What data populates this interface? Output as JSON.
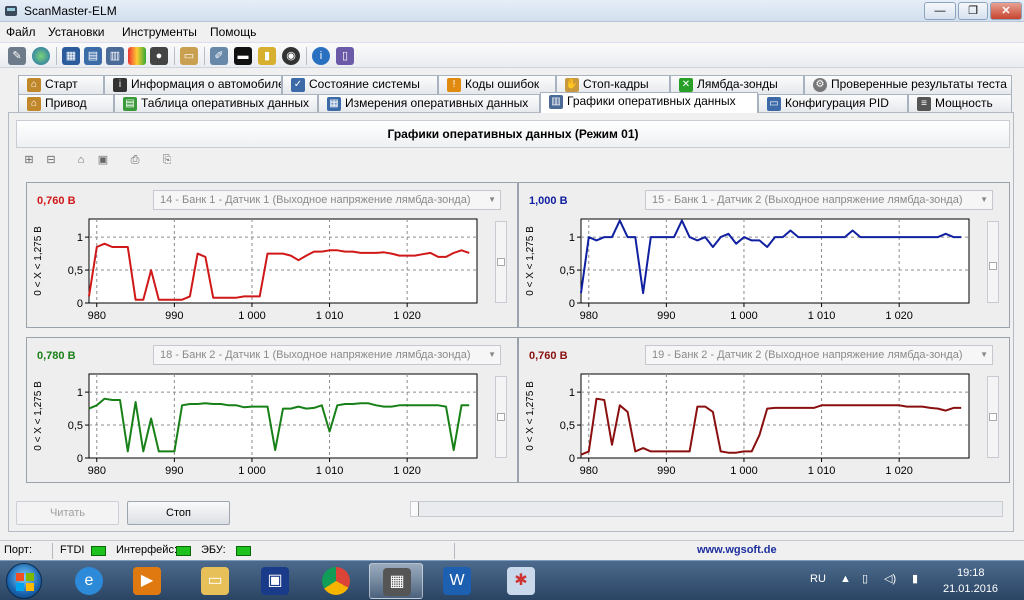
{
  "window": {
    "title": "ScanMaster-ELM",
    "controls": {
      "minimize": "—",
      "maximize": "❐",
      "close": "✕"
    }
  },
  "menu": [
    "Файл",
    "Установки",
    "Инструменты",
    "Помощь"
  ],
  "toolbar_icons": [
    "connect-icon",
    "globe-icon",
    "grid-icon",
    "chart-icon",
    "color-icon",
    "traffic-light-icon",
    "clipboard-icon",
    "pen-icon",
    "terminal-icon",
    "disk-icon",
    "info-icon",
    "book-icon"
  ],
  "tabs_row1": [
    "Старт",
    "Информация о автомобиле",
    "Состояние системы",
    "Коды ошибок",
    "Стоп-кадры",
    "Лямбда-зонды",
    "Проверенные результаты теста"
  ],
  "tabs_row2": [
    "Привод",
    "Таблица оперативных данных",
    "Измерения оперативных данных",
    "Графики оперативных данных",
    "Конфигурация PID",
    "Мощность"
  ],
  "active_tab": "Графики оперативных данных",
  "panel_title": "Графики оперативных данных (Режим 01)",
  "charts": [
    {
      "current_value": "0,760 В",
      "sensor": "14 - Банк 1 - Датчик 1 (Выходное напряжение лямбда-зонда)",
      "color": "#d01818"
    },
    {
      "current_value": "1,000 В",
      "sensor": "15 - Банк 1 - Датчик 2 (Выходное напряжение лямбда-зонда)",
      "color": "#1020a0"
    },
    {
      "current_value": "0,780 В",
      "sensor": "18 - Банк 2 - Датчик 1 (Выходное напряжение лямбда-зонда)",
      "color": "#188018"
    },
    {
      "current_value": "0,760 В",
      "sensor": "19 - Банк 2 - Датчик 2 (Выходное напряжение лямбда-зонда)",
      "color": "#8a1010"
    }
  ],
  "chart_data": [
    {
      "type": "line",
      "title": "0,760 В",
      "ylabel": "0 < X < 1,275 В",
      "xlim": [
        979,
        1029
      ],
      "ylim": [
        0,
        1
      ],
      "xticks": [
        "980",
        "990",
        "1 000",
        "1 010",
        "1 020"
      ],
      "yticks": [
        "0",
        "0,5",
        "1"
      ],
      "series": [
        {
          "color": "#d01818",
          "x": [
            979,
            980,
            981,
            982,
            983,
            984,
            985,
            986,
            987,
            988,
            989,
            990,
            991,
            992,
            993,
            994,
            995,
            996,
            997,
            998,
            999,
            1000,
            1001,
            1002,
            1003,
            1004,
            1005,
            1006,
            1007,
            1008,
            1009,
            1010,
            1011,
            1012,
            1013,
            1014,
            1015,
            1016,
            1017,
            1018,
            1019,
            1020,
            1021,
            1022,
            1023,
            1024,
            1025,
            1026,
            1027,
            1028
          ],
          "y": [
            0.1,
            0.85,
            0.9,
            0.85,
            0.85,
            0.85,
            0.05,
            0.05,
            0.5,
            0.05,
            0.05,
            0.05,
            0.05,
            0.1,
            0.75,
            0.7,
            0.08,
            0.08,
            0.08,
            0.08,
            0.1,
            0.1,
            0.1,
            0.75,
            0.75,
            0.75,
            0.72,
            0.65,
            0.72,
            0.78,
            0.78,
            0.8,
            0.8,
            0.78,
            0.78,
            0.76,
            0.76,
            0.76,
            0.77,
            0.75,
            0.72,
            0.72,
            0.72,
            0.74,
            0.76,
            0.7,
            0.7,
            0.76,
            0.8,
            0.76
          ]
        }
      ]
    },
    {
      "type": "line",
      "title": "1,000 В",
      "ylabel": "0 < X < 1,275 В",
      "xlim": [
        979,
        1029
      ],
      "ylim": [
        0,
        1
      ],
      "xticks": [
        "980",
        "990",
        "1 000",
        "1 010",
        "1 020"
      ],
      "yticks": [
        "0",
        "0,5",
        "1"
      ],
      "series": [
        {
          "color": "#1020a0",
          "x": [
            979,
            980,
            981,
            982,
            983,
            984,
            985,
            986,
            987,
            988,
            989,
            990,
            991,
            992,
            993,
            994,
            995,
            996,
            997,
            998,
            999,
            1000,
            1001,
            1002,
            1003,
            1004,
            1005,
            1006,
            1007,
            1008,
            1009,
            1010,
            1011,
            1012,
            1013,
            1014,
            1015,
            1016,
            1017,
            1018,
            1019,
            1020,
            1021,
            1022,
            1023,
            1024,
            1025,
            1026,
            1027,
            1028
          ],
          "y": [
            0.15,
            1.0,
            0.95,
            1.0,
            1.0,
            1.25,
            1.0,
            1.0,
            0.15,
            1.0,
            1.0,
            1.0,
            1.0,
            1.25,
            1.0,
            0.95,
            1.0,
            0.85,
            1.0,
            1.05,
            0.9,
            1.0,
            0.95,
            0.95,
            0.85,
            1.0,
            1.0,
            1.1,
            1.0,
            1.0,
            1.0,
            1.0,
            1.0,
            1.0,
            1.0,
            1.1,
            1.0,
            1.0,
            1.0,
            1.0,
            1.0,
            1.0,
            1.0,
            1.0,
            1.0,
            1.0,
            1.0,
            1.05,
            1.0,
            1.0
          ]
        }
      ]
    },
    {
      "type": "line",
      "title": "0,780 В",
      "ylabel": "0 < X < 1,275 В",
      "xlim": [
        979,
        1029
      ],
      "ylim": [
        0,
        1
      ],
      "xticks": [
        "980",
        "990",
        "1 000",
        "1 010",
        "1 020"
      ],
      "yticks": [
        "0",
        "0,5",
        "1"
      ],
      "series": [
        {
          "color": "#188018",
          "x": [
            979,
            980,
            981,
            982,
            983,
            984,
            985,
            986,
            987,
            988,
            989,
            990,
            991,
            992,
            993,
            994,
            995,
            996,
            997,
            998,
            999,
            1000,
            1001,
            1002,
            1003,
            1004,
            1005,
            1006,
            1007,
            1008,
            1009,
            1010,
            1011,
            1012,
            1013,
            1014,
            1015,
            1016,
            1017,
            1018,
            1019,
            1020,
            1021,
            1022,
            1023,
            1024,
            1025,
            1026,
            1027,
            1028
          ],
          "y": [
            0.75,
            0.8,
            0.9,
            0.88,
            0.88,
            0.1,
            0.85,
            0.1,
            0.6,
            0.1,
            0.1,
            0.1,
            0.8,
            0.82,
            0.82,
            0.83,
            0.82,
            0.82,
            0.8,
            0.8,
            0.77,
            0.78,
            0.78,
            0.78,
            0.12,
            0.75,
            0.75,
            0.78,
            0.75,
            0.76,
            0.8,
            0.4,
            0.8,
            0.82,
            0.82,
            0.83,
            0.83,
            0.8,
            0.78,
            0.78,
            0.8,
            0.8,
            0.8,
            0.8,
            0.8,
            0.8,
            0.78,
            0.12,
            0.8,
            0.8
          ]
        }
      ]
    },
    {
      "type": "line",
      "title": "0,760 В",
      "ylabel": "0 < X < 1,275 В",
      "xlim": [
        979,
        1029
      ],
      "ylim": [
        0,
        1
      ],
      "xticks": [
        "980",
        "990",
        "1 000",
        "1 010",
        "1 020"
      ],
      "yticks": [
        "0",
        "0,5",
        "1"
      ],
      "series": [
        {
          "color": "#8a1010",
          "x": [
            979,
            980,
            981,
            982,
            983,
            984,
            985,
            986,
            987,
            988,
            989,
            990,
            991,
            992,
            993,
            994,
            995,
            996,
            997,
            998,
            999,
            1000,
            1001,
            1002,
            1003,
            1004,
            1005,
            1006,
            1007,
            1008,
            1009,
            1010,
            1011,
            1012,
            1013,
            1014,
            1015,
            1016,
            1017,
            1018,
            1019,
            1020,
            1021,
            1022,
            1023,
            1024,
            1025,
            1026,
            1027,
            1028
          ],
          "y": [
            0.05,
            0.1,
            0.9,
            0.88,
            0.2,
            0.8,
            0.7,
            0.1,
            0.15,
            0.1,
            0.1,
            0.1,
            0.1,
            0.1,
            0.1,
            0.78,
            0.78,
            0.7,
            0.1,
            0.08,
            0.08,
            0.1,
            0.1,
            0.35,
            0.75,
            0.76,
            0.76,
            0.76,
            0.76,
            0.76,
            0.76,
            0.8,
            0.8,
            0.8,
            0.8,
            0.8,
            0.8,
            0.8,
            0.8,
            0.8,
            0.8,
            0.8,
            0.78,
            0.78,
            0.78,
            0.76,
            0.75,
            0.72,
            0.76,
            0.76
          ]
        }
      ]
    }
  ],
  "buttons": {
    "read": "Читать",
    "stop": "Стоп"
  },
  "status": {
    "port_label": "Порт:",
    "ftdi_label": "FTDI",
    "interface_label": "Интерфейс:",
    "ecu_label": "ЭБУ:",
    "website": "www.wgsoft.de"
  },
  "taskbar": {
    "language": "RU",
    "time": "19:18",
    "date": "21.01.2016"
  }
}
